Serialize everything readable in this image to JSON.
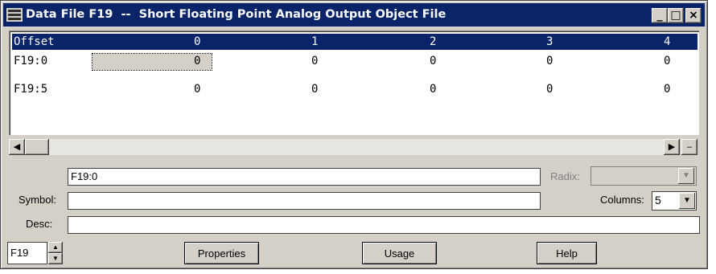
{
  "window": {
    "title": "Data File F19  --  Short Floating Point Analog Output Object File",
    "buttons": {
      "minimize": "_",
      "maximize": "□",
      "close": "×"
    }
  },
  "grid": {
    "header": {
      "offset_label": "Offset",
      "columns": [
        "0",
        "1",
        "2",
        "3",
        "4"
      ]
    },
    "rows": [
      {
        "address": "F19:0",
        "values": [
          "0",
          "0",
          "0",
          "0",
          "0"
        ]
      },
      {
        "address": "F19:5",
        "values": [
          "0",
          "0",
          "0",
          "0",
          "0"
        ]
      }
    ],
    "selected_cell": {
      "row": 0,
      "col": 0
    }
  },
  "address_field": {
    "value": "F19:0"
  },
  "radix": {
    "label": "Radix:",
    "value": ""
  },
  "symbol": {
    "label": "Symbol:",
    "value": ""
  },
  "columns": {
    "label": "Columns:",
    "value": "5"
  },
  "desc": {
    "label": "Desc:",
    "value": ""
  },
  "file_spinner": {
    "value": "F19"
  },
  "buttons": {
    "properties": "Properties",
    "usage": "Usage",
    "help": "Help"
  },
  "icons": {
    "title": "data-file-icon",
    "scroll_left": "scroll-left-arrow-icon",
    "scroll_right": "scroll-right-arrow-icon",
    "spin_up": "spin-up-arrow-icon",
    "spin_down": "spin-down-arrow-icon"
  },
  "colors": {
    "title_bar": "#0a246a",
    "face": "#d4d0c8",
    "field": "#ffffff"
  }
}
